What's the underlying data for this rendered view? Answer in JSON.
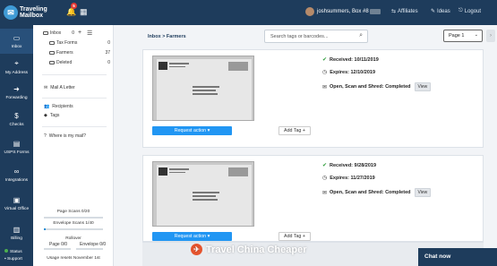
{
  "app": {
    "brand_line1": "Traveling",
    "brand_line2": "Mailbox"
  },
  "topbar": {
    "notification_count": "5",
    "user_label": "joshsummers, Box #8",
    "links": [
      "Affiliates",
      "Ideas",
      "Logout"
    ]
  },
  "sidebar": {
    "items": [
      {
        "label": "Inbox",
        "icon": "inbox-icon"
      },
      {
        "label": "My Address",
        "icon": "location-pin-icon"
      },
      {
        "label": "Forwarding",
        "icon": "forward-arrow-icon"
      },
      {
        "label": "Checks",
        "icon": "check-icon"
      },
      {
        "label": "USPS Forms",
        "icon": "document-icon"
      },
      {
        "label": "Integrations",
        "icon": "link-icon"
      },
      {
        "label": "Virtual Office",
        "icon": "briefcase-icon"
      },
      {
        "label": "Billing",
        "icon": "billing-icon"
      }
    ],
    "status_label": "Status",
    "support_label": "Support"
  },
  "folders": {
    "inbox_label": "Inbox",
    "inbox_count": "0",
    "items": [
      {
        "label": "Tax Forms",
        "count": "0"
      },
      {
        "label": "Farmers",
        "count": "37"
      },
      {
        "label": "Deleted",
        "count": "0"
      }
    ],
    "mail_letter": "Mail A Letter",
    "recipients": "Recipients",
    "tags": "Tags",
    "where_mail": "Where is my mail?",
    "page_scans": "Page Scans 0/20",
    "envelope_scans": "Envelope Scans 1/40",
    "rollover": "Rollover",
    "rollover_page": "Page 0/0",
    "rollover_envelope": "Envelope 0/0",
    "usage_resets": "Usage resets November 1st",
    "page_scans_progress": 0,
    "envelope_scans_progress": 0.025
  },
  "main": {
    "breadcrumb": "Inbox > Farmers",
    "search_placeholder": "Search tags or barcodes...",
    "page_select": "Page 1",
    "cards": [
      {
        "received": "Received: 10/11/2019",
        "expires": "Expires: 12/10/2019",
        "status": "Open, Scan and Shred: Completed",
        "view": "View",
        "request_action": "Request action",
        "add_tag": "Add Tag"
      },
      {
        "received": "Received: 9/28/2019",
        "expires": "Expires: 11/27/2019",
        "status": "Open, Scan and Shred: Completed",
        "view": "View",
        "request_action": "Request action",
        "add_tag": "Add Tag"
      }
    ]
  },
  "watermark": "Travel China Cheaper",
  "chat": "Chat now",
  "colors": {
    "nav": "#1e3c5c",
    "accent": "#2196f3",
    "success": "#2e9d3a"
  }
}
